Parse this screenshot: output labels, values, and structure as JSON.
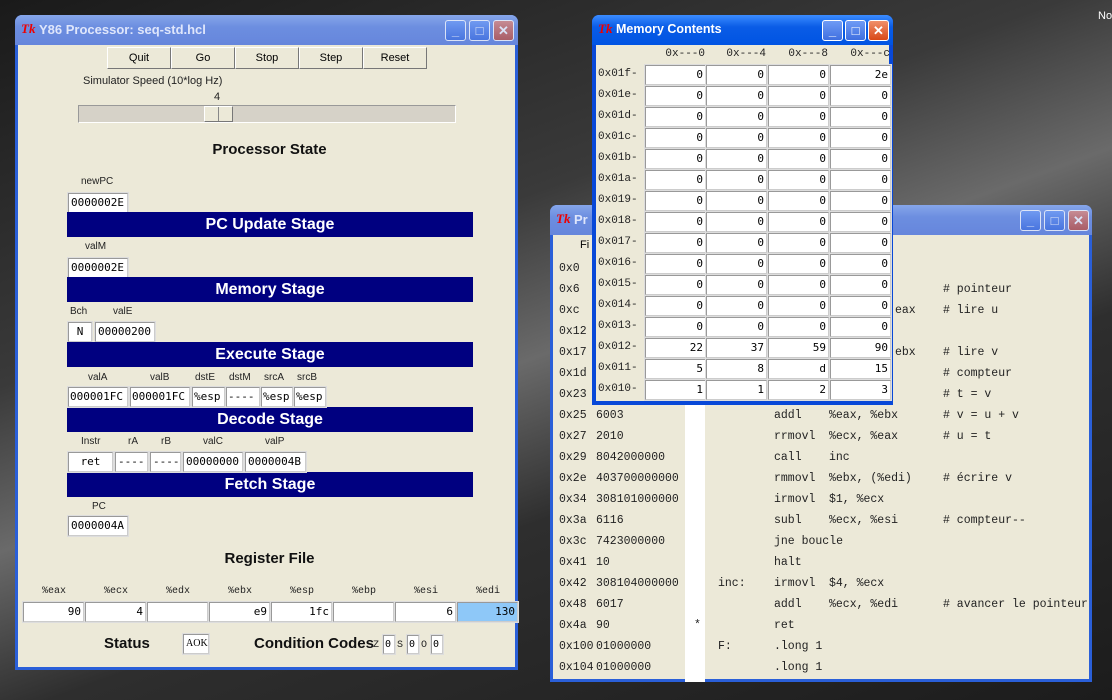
{
  "desktop": {
    "corner_text": "No"
  },
  "processor": {
    "title": "Y86 Processor: seq-std.hcl",
    "buttons": [
      "Quit",
      "Go",
      "Stop",
      "Step",
      "Reset"
    ],
    "speed_label": "Simulator Speed (10*log Hz)",
    "speed_value": "4",
    "speed_fraction": 0.36,
    "state_title": "Processor State",
    "pc_update": {
      "stage": "PC Update Stage",
      "newPC_label": "newPC",
      "newPC": "0000002E"
    },
    "memory": {
      "stage": "Memory Stage",
      "valM_label": "valM",
      "valM": "0000002E"
    },
    "execute": {
      "stage": "Execute Stage",
      "Bch_label": "Bch",
      "Bch": "N",
      "valE_label": "valE",
      "valE": "00000200"
    },
    "decode": {
      "stage": "Decode Stage",
      "labels": [
        "valA",
        "valB",
        "dstE",
        "dstM",
        "srcA",
        "srcB"
      ],
      "values": [
        "000001FC",
        "000001FC",
        "%esp",
        "----",
        "%esp",
        "%esp"
      ]
    },
    "fetch": {
      "stage": "Fetch Stage",
      "labels": [
        "Instr",
        "rA",
        "rB",
        "valC",
        "valP"
      ],
      "values": [
        "ret",
        "----",
        "----",
        "00000000",
        "0000004B"
      ]
    },
    "pc": {
      "label": "PC",
      "value": "0000004A"
    },
    "register_file": {
      "title": "Register File",
      "names": [
        "%eax",
        "%ecx",
        "%edx",
        "%ebx",
        "%esp",
        "%ebp",
        "%esi",
        "%edi"
      ],
      "values": [
        "90",
        "4",
        "",
        "e9",
        "1fc",
        "",
        "6",
        "130"
      ],
      "highlight_index": 7,
      "highlight_color": "#8ec8f8"
    },
    "status": {
      "label": "Status",
      "value": "AOK",
      "cc_label": "Condition Codes",
      "cc": [
        {
          "name": "Z",
          "value": "0"
        },
        {
          "name": "S",
          "value": "0"
        },
        {
          "name": "O",
          "value": "0"
        }
      ]
    }
  },
  "memory_window": {
    "title": "Memory Contents",
    "columns": [
      "0x---0",
      "0x---4",
      "0x---8",
      "0x---c"
    ],
    "rows": [
      {
        "addr": "0x01f-",
        "v": [
          "0",
          "0",
          "0",
          "2e"
        ]
      },
      {
        "addr": "0x01e-",
        "v": [
          "0",
          "0",
          "0",
          "0"
        ]
      },
      {
        "addr": "0x01d-",
        "v": [
          "0",
          "0",
          "0",
          "0"
        ]
      },
      {
        "addr": "0x01c-",
        "v": [
          "0",
          "0",
          "0",
          "0"
        ]
      },
      {
        "addr": "0x01b-",
        "v": [
          "0",
          "0",
          "0",
          "0"
        ]
      },
      {
        "addr": "0x01a-",
        "v": [
          "0",
          "0",
          "0",
          "0"
        ]
      },
      {
        "addr": "0x019-",
        "v": [
          "0",
          "0",
          "0",
          "0"
        ]
      },
      {
        "addr": "0x018-",
        "v": [
          "0",
          "0",
          "0",
          "0"
        ]
      },
      {
        "addr": "0x017-",
        "v": [
          "0",
          "0",
          "0",
          "0"
        ]
      },
      {
        "addr": "0x016-",
        "v": [
          "0",
          "0",
          "0",
          "0"
        ]
      },
      {
        "addr": "0x015-",
        "v": [
          "0",
          "0",
          "0",
          "0"
        ]
      },
      {
        "addr": "0x014-",
        "v": [
          "0",
          "0",
          "0",
          "0"
        ]
      },
      {
        "addr": "0x013-",
        "v": [
          "0",
          "0",
          "0",
          "0"
        ]
      },
      {
        "addr": "0x012-",
        "v": [
          "22",
          "37",
          "59",
          "90"
        ]
      },
      {
        "addr": "0x011-",
        "v": [
          "5",
          "8",
          "d",
          "15"
        ]
      },
      {
        "addr": "0x010-",
        "v": [
          "1",
          "1",
          "2",
          "3"
        ]
      }
    ]
  },
  "code_window": {
    "title": "Pr",
    "menu": "Fi",
    "lines": [
      {
        "addr": "0x0",
        "code": "",
        "mark": "",
        "label": "",
        "instr": "",
        "operand": "",
        "tail": "",
        "comment": ""
      },
      {
        "addr": "0x6",
        "code": "",
        "mark": "",
        "label": "",
        "instr": "",
        "operand": "",
        "tail": "",
        "comment": "# pointeur"
      },
      {
        "addr": "0xc",
        "code": "",
        "mark": "",
        "label": "",
        "instr": "",
        "operand": "",
        "tail": "eax",
        "comment": "# lire u"
      },
      {
        "addr": "0x12",
        "code": "",
        "mark": "",
        "label": "",
        "instr": "",
        "operand": "",
        "tail": "",
        "comment": ""
      },
      {
        "addr": "0x17",
        "code": "",
        "mark": "",
        "label": "",
        "instr": "",
        "operand": "",
        "tail": "ebx",
        "comment": "# lire v"
      },
      {
        "addr": "0x1d",
        "code": "",
        "mark": "",
        "label": "",
        "instr": "",
        "operand": "",
        "tail": "",
        "comment": "# compteur"
      },
      {
        "addr": "0x23",
        "code": "",
        "mark": "",
        "label": "",
        "instr": "",
        "operand": "",
        "tail": "",
        "comment": "# t = v"
      },
      {
        "addr": "0x25",
        "code": "6003",
        "mark": "",
        "label": "",
        "instr": "addl",
        "operand": "%eax, %ebx",
        "tail": "",
        "comment": "# v = u + v"
      },
      {
        "addr": "0x27",
        "code": "2010",
        "mark": "",
        "label": "",
        "instr": "rrmovl",
        "operand": "%ecx, %eax",
        "tail": "",
        "comment": "# u = t"
      },
      {
        "addr": "0x29",
        "code": "8042000000",
        "mark": "",
        "label": "",
        "instr": "call",
        "operand": "inc",
        "tail": "",
        "comment": ""
      },
      {
        "addr": "0x2e",
        "code": "403700000000",
        "mark": "",
        "label": "",
        "instr": "rmmovl",
        "operand": "%ebx, (%edi)",
        "tail": "",
        "comment": "# écrire v"
      },
      {
        "addr": "0x34",
        "code": "308101000000",
        "mark": "",
        "label": "",
        "instr": "irmovl",
        "operand": "$1, %ecx",
        "tail": "",
        "comment": ""
      },
      {
        "addr": "0x3a",
        "code": "6116",
        "mark": "",
        "label": "",
        "instr": "subl",
        "operand": "%ecx, %esi",
        "tail": "",
        "comment": "# compteur--"
      },
      {
        "addr": "0x3c",
        "code": "7423000000",
        "mark": "",
        "label": "",
        "instr": "jne boucle",
        "operand": "",
        "tail": "",
        "comment": ""
      },
      {
        "addr": "0x41",
        "code": "10",
        "mark": "",
        "label": "",
        "instr": "halt",
        "operand": "",
        "tail": "",
        "comment": ""
      },
      {
        "addr": "0x42",
        "code": "308104000000",
        "mark": "",
        "label": "inc:",
        "instr": "irmovl",
        "operand": "$4, %ecx",
        "tail": "",
        "comment": ""
      },
      {
        "addr": "0x48",
        "code": "6017",
        "mark": "",
        "label": "",
        "instr": "addl",
        "operand": "%ecx, %edi",
        "tail": "",
        "comment": "# avancer le pointeur"
      },
      {
        "addr": "0x4a",
        "code": "90",
        "mark": "*",
        "label": "",
        "instr": "ret",
        "operand": "",
        "tail": "",
        "comment": ""
      },
      {
        "addr": "0x100",
        "code": "01000000",
        "mark": "",
        "label": "F:",
        "instr": ".long 1",
        "operand": "",
        "tail": "",
        "comment": ""
      },
      {
        "addr": "0x104",
        "code": "01000000",
        "mark": "",
        "label": "",
        "instr": ".long 1",
        "operand": "",
        "tail": "",
        "comment": ""
      }
    ]
  }
}
